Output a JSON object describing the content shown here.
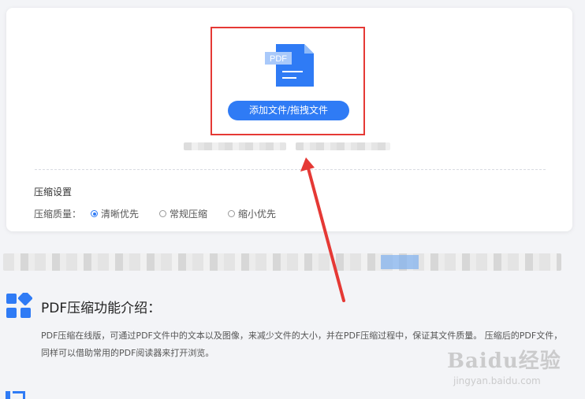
{
  "upload": {
    "file_icon_badge": "PDF",
    "add_button_label": "添加文件/拖拽文件"
  },
  "settings": {
    "title": "压缩设置",
    "quality_label": "压缩质量：",
    "options": [
      {
        "label": "清晰优先",
        "selected": true
      },
      {
        "label": "常规压缩",
        "selected": false
      },
      {
        "label": "缩小优先",
        "selected": false
      }
    ]
  },
  "intro": {
    "title": "PDF压缩功能介绍：",
    "description": "PDF压缩在线版，可通过PDF文件中的文本以及图像，来减少文件的大小，并在PDF压缩过程中，保证其文件质量。 压缩后的PDF文件，同样可以借助常用的PDF阅读器来打开浏览。"
  },
  "watermark": {
    "brand": "Baidu经验",
    "url": "jingyan.baidu.com"
  },
  "colors": {
    "accent": "#2f7bf5",
    "highlight": "#e53935"
  }
}
